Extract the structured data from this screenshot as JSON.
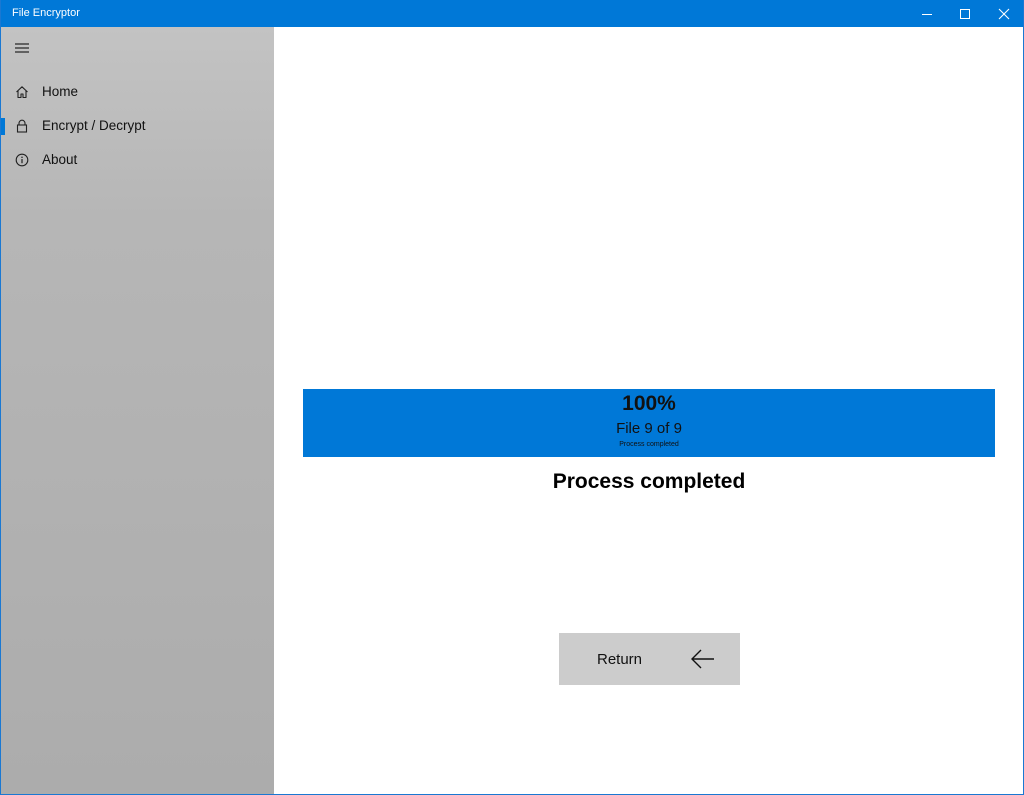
{
  "window": {
    "title": "File Encryptor",
    "controls": {
      "minimize_icon": "minimize-icon",
      "maximize_icon": "maximize-icon",
      "close_icon": "close-icon"
    }
  },
  "sidebar": {
    "menu_icon": "hamburger-menu-icon",
    "items": [
      {
        "label": "Home",
        "icon": "home-icon",
        "selected": false
      },
      {
        "label": "Encrypt / Decrypt",
        "icon": "lock-icon",
        "selected": true
      },
      {
        "label": "About",
        "icon": "info-icon",
        "selected": false
      }
    ]
  },
  "progress": {
    "percent_text": "100%",
    "fraction": 1.0,
    "file_status": "File 9 of 9",
    "sub_status": "Process completed"
  },
  "status": {
    "heading": "Process completed"
  },
  "actions": {
    "return_label": "Return",
    "return_icon": "arrow-left-icon"
  },
  "colors": {
    "accent": "#0078d7",
    "sidebar_background": "#b4b4b4",
    "button_background": "#cccccc"
  }
}
